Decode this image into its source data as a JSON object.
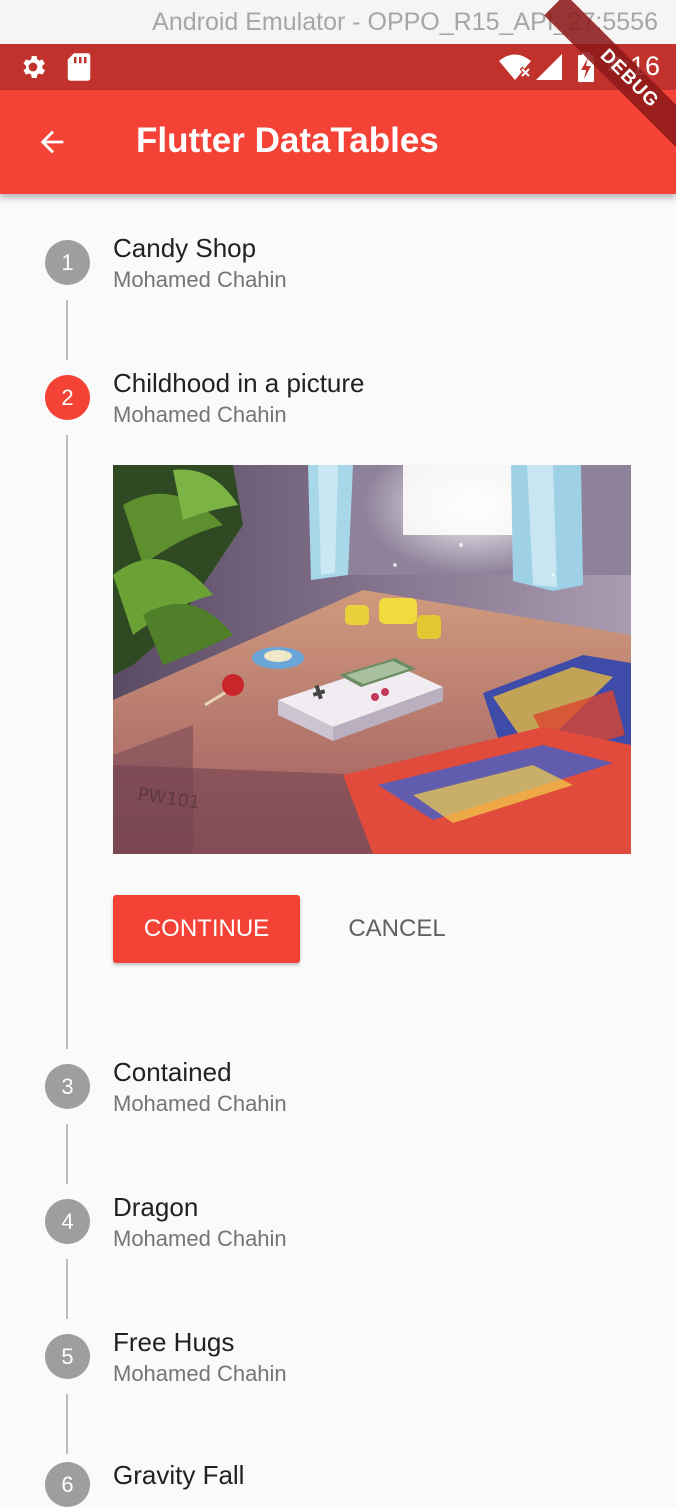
{
  "emulator": {
    "title": "Android Emulator - OPPO_R15_API_27:5556"
  },
  "statusbar": {
    "time": "4:16"
  },
  "appbar": {
    "title": "Flutter DataTables"
  },
  "debug_banner": "DEBUG",
  "colors": {
    "accent": "#f44336",
    "statusbar": "#c0322b",
    "inactive_step": "#9e9e9e"
  },
  "steps": [
    {
      "number": "1",
      "title": "Candy Shop",
      "subtitle": "Mohamed Chahin"
    },
    {
      "number": "2",
      "title": "Childhood in a picture",
      "subtitle": "Mohamed Chahin"
    },
    {
      "number": "3",
      "title": "Contained",
      "subtitle": "Mohamed Chahin"
    },
    {
      "number": "4",
      "title": "Dragon",
      "subtitle": "Mohamed Chahin"
    },
    {
      "number": "5",
      "title": "Free Hugs",
      "subtitle": "Mohamed Chahin"
    },
    {
      "number": "6",
      "title": "Gravity Fall",
      "subtitle": ""
    }
  ],
  "controls": {
    "continue_label": "CONTINUE",
    "cancel_label": "CANCEL"
  },
  "image": {
    "alt": "Childhood in a picture",
    "label": "PW101"
  }
}
